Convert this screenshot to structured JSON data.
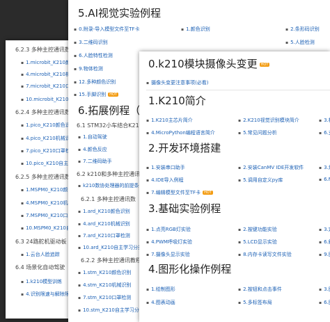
{
  "colors": {
    "link": "#1a5fb4",
    "hot_badge": "#f39c12",
    "background": "#2b2b2b"
  },
  "hot_badge_label": "HOT",
  "back_panel": {
    "s1": "6.2.3 多种主控通讯数",
    "s1_items": [
      "1.microbit_K210颜色识",
      "4.microbit_K210机械识",
      "7.microbit_K210口罩检",
      "10.microbit_K210自主"
    ],
    "s2": "6.2.4 多种主控通讯数",
    "s2_items": [
      "1.pico_K210颜色识别",
      "4.pico_K210机械识别",
      "7.pico_K210口罩检测",
      "10.pico_K210自主学习"
    ],
    "s3": "6.2.5 多种主控通讯数",
    "s3_items": [
      "1.MSPM0_K210颜色识",
      "4.MSPM0_K210机械识",
      "7.MSPM0_K210口罩检",
      "10.MSPM0_K210自主学"
    ],
    "s4": "6.3 24路舵机驱动板",
    "s4_items": [
      "1.云台人脸追踪"
    ],
    "s5": "6.4 场景化自动驾驶",
    "s5_items": [
      "1.k210模型训练",
      "4.识别限速与解除限速"
    ]
  },
  "middle_panel": {
    "title": "5.AI视觉实验例程",
    "rows": [
      [
        "0.附录-导入模型文件至TF卡",
        "1.颜色识别",
        "2.条形码识别"
      ],
      [
        "3.二维码识别",
        "4.",
        "5.人脸检测"
      ],
      [
        "6.人脸特性检测",
        "",
        ""
      ],
      [
        "9.物体检测",
        "",
        ""
      ],
      [
        "12.多种颜色识别",
        "",
        ""
      ],
      [
        "15.手脚识别",
        "",
        ""
      ]
    ],
    "title2": "6.拓展例程（",
    "s61": "6.1 STM32小车结合K210",
    "s61_items": [
      "1.自动驾驶",
      "4.颜色反应",
      "7.二维码助手"
    ],
    "s62": "6.2 k210和多种主控通讯",
    "s62_link": "k210数协处理器的前提条件",
    "s621": "6.2.1 多种主控通讯数",
    "s621_items": [
      "1.ard_K210颜色识别",
      "4.ard_K210机械识别",
      "7.ard_K210口罩检测",
      "10.ard_K210自主学习分类"
    ],
    "s622": "6.2.2 多种主控通讯教程",
    "s622_items": [
      "1.stm_K210颜色识别",
      "4.stm_K210机械识别",
      "7.stm_K210口罩检测",
      "10.stm_K210自主学习分类"
    ]
  },
  "front_panel": {
    "title0": "0.k210模块摄像头变更",
    "item0": "摄像头变更注意事项(必看)",
    "title1": "1.K210简介",
    "row1": [
      "1.K210主芯片简介",
      "2.K210视觉识别模块简介",
      "3.模块"
    ],
    "row1b": [
      "4.MicroPython编程语言简介",
      "5.常见问题分析",
      "6.支架"
    ],
    "title2": "2.开发环境搭建",
    "row2": [
      "1.安装串口助手",
      "2.安装CanMV IDE开发软件",
      "3.烧录"
    ],
    "row2b": [
      "4.IDE导入例程",
      "5.调用自定义py库",
      "6.Micro"
    ],
    "row2c": [
      "7.编辑模型文件至TF卡",
      "",
      ""
    ],
    "title3": "3.基础实验例程",
    "row3": [
      "1.点亮RGB灯实验",
      "2.按键功能实验",
      "3.定时"
    ],
    "row3b": [
      "4.PWM呼吸灯实验",
      "5.LCD显示实验",
      "6.触摸"
    ],
    "row3c": [
      "7.摄像头显示实验",
      "8.内存卡读写文件实验",
      "9.图"
    ],
    "title4": "4.图形化操作例程",
    "row4": [
      "1.绘制图形",
      "2.按钮和点击事件",
      "3.图"
    ],
    "row4b": [
      "4.图表动画",
      "5.多标签布局",
      "6.图"
    ]
  }
}
